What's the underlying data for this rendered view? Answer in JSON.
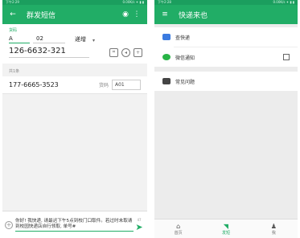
{
  "left": {
    "status": {
      "time": "下午2:29",
      "right": "0.00K/s ✦ ▮ ▮"
    },
    "appbar": {
      "back": "←",
      "title": "群发短信",
      "eye": "◉",
      "more": "⋮"
    },
    "form": {
      "code_label": "货码",
      "code_prefix": "A",
      "code_start": "02",
      "mode": "递增",
      "caret": "▾",
      "phone": "126-6632-321"
    },
    "count": "共1条",
    "items": [
      {
        "number": "177-6665-3523",
        "code_label": "货码",
        "code": "A01"
      }
    ],
    "composer": {
      "plus": "+",
      "message": "你好! 我快递, 请最迟下午5点到校门口取件。若过时未取请到校园快递店自行领取, 单号#",
      "count": "47",
      "send": "➤"
    }
  },
  "right": {
    "status": {
      "time": "下午2:28",
      "right": "0.00K/s ✦ ▮ ▮"
    },
    "appbar": {
      "menu": "≡",
      "title": "快递来也"
    },
    "menu": [
      {
        "label": "查快递",
        "color": "#3b7be0"
      },
      {
        "label": "微信通知",
        "color": "#28b446"
      }
    ],
    "menu2": [
      {
        "label": "常见问题",
        "color": "#444444"
      }
    ],
    "tabs": [
      {
        "label": "首页",
        "icon": "⌂"
      },
      {
        "label": "发短",
        "icon": "◥"
      },
      {
        "label": "我",
        "icon": "♟"
      }
    ]
  }
}
